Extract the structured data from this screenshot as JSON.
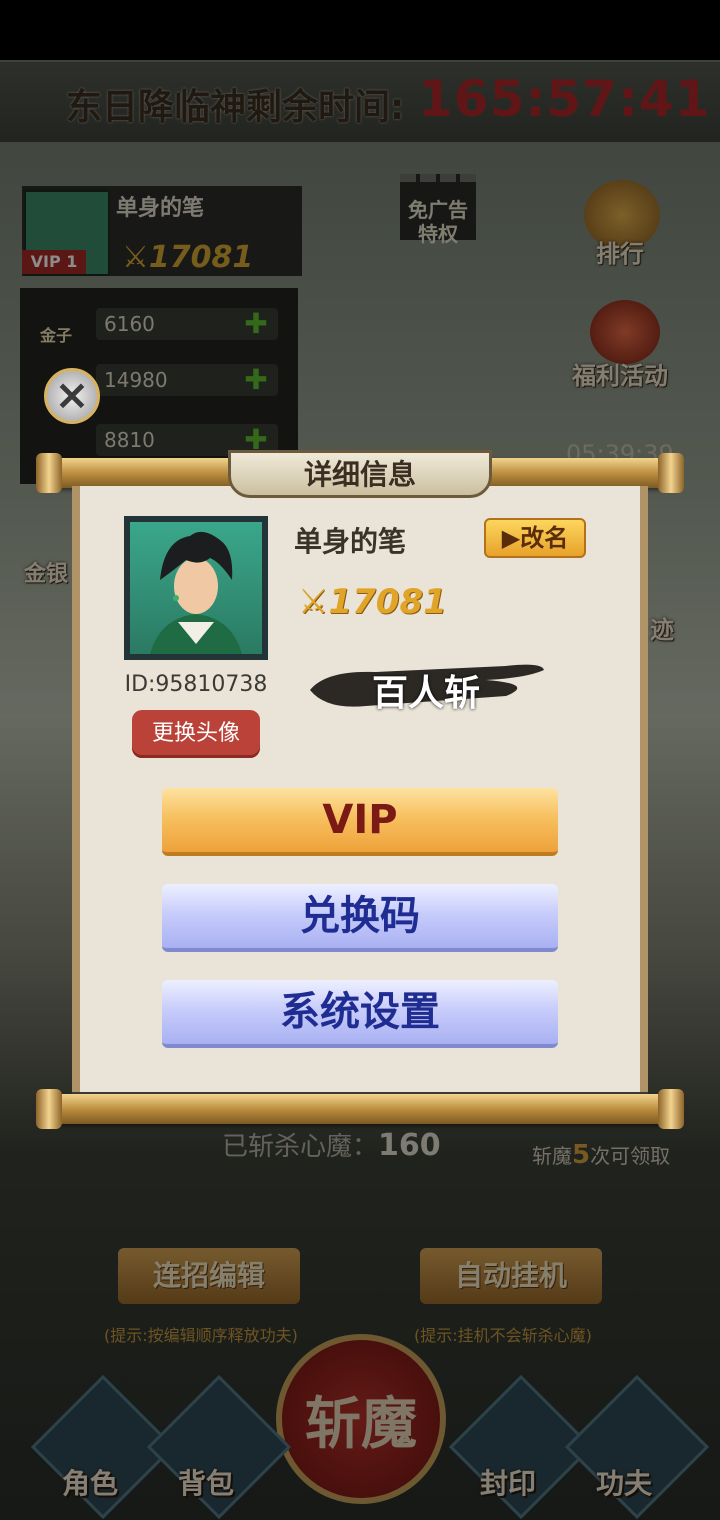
{
  "background": {
    "timer": {
      "label": "东日降临神剩余时间:",
      "value": "165:57:41"
    },
    "player": {
      "name": "单身的笔",
      "vip": "VIP 1",
      "power": "17081"
    },
    "resources": [
      {
        "label": "金子",
        "value": "6160"
      },
      {
        "label": "",
        "value": "14980"
      },
      {
        "label": "",
        "value": "8810"
      }
    ],
    "ad_free": "免广告\n特权",
    "side_buttons": {
      "rank": "排行",
      "welfare": "福利活动",
      "left_partial": "金银",
      "right_partial": "迹"
    },
    "side_timer": "05:39:39",
    "kills": {
      "label": "已斩杀心魔：",
      "value": "160"
    },
    "reward": {
      "prefix": "斩魔",
      "count": "5",
      "suffix": "次可领取"
    },
    "combo_button": "连招编辑",
    "combo_tip": "(提示:按编辑顺序释放功夫)",
    "auto_button": "自动挂机",
    "auto_tip": "(提示:挂机不会斩杀心魔)",
    "kill_button": "斩魔",
    "nav": [
      "角色",
      "背包",
      "封印",
      "功夫"
    ]
  },
  "dialog": {
    "title": "详细信息",
    "name": "单身的笔",
    "rename_label": "改名",
    "power": "17081",
    "player_title": "百人斩",
    "id_text": "ID:95810738",
    "change_avatar_label": "更换头像",
    "vip_label": "VIP",
    "redeem_label": "兑换码",
    "settings_label": "系统设置"
  },
  "colors": {
    "accent_gold": "#eea23a",
    "accent_blue": "#a9b1f2",
    "accent_red": "#ba4238"
  }
}
